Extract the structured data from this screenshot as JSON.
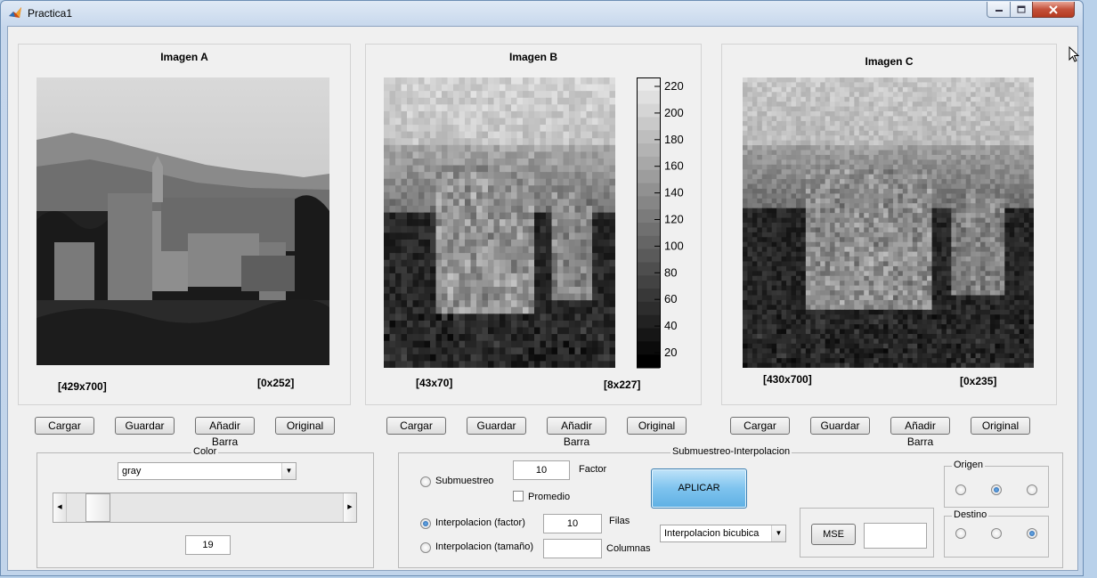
{
  "window": {
    "title": "Practica1"
  },
  "panels": {
    "a": {
      "title": "Imagen A",
      "size_label": "[429x700]",
      "range_label": "[0x252]"
    },
    "b": {
      "title": "Imagen B",
      "size_label": "[43x70]",
      "range_label": "[8x227]"
    },
    "c": {
      "title": "Imagen C",
      "size_label": "[430x700]",
      "range_label": "[0x235]"
    }
  },
  "colorbar": {
    "ticks": [
      "220",
      "200",
      "180",
      "160",
      "140",
      "120",
      "100",
      "80",
      "60",
      "40",
      "20"
    ]
  },
  "buttons": {
    "cargar": "Cargar",
    "guardar": "Guardar",
    "anadir_barra": "Añadir Barra",
    "original": "Original"
  },
  "color_group": {
    "label": "Color",
    "colormap_selected": "gray",
    "slider_value": "19"
  },
  "sub_group": {
    "label": "Submuestreo-Interpolacion",
    "submuestreo_label": "Submuestreo",
    "factor_value": "10",
    "factor_label": "Factor",
    "promedio_label": "Promedio",
    "interp_factor_label": "Interpolacion (factor)",
    "filas_value": "10",
    "filas_label": "Filas",
    "interp_tamano_label": "Interpolacion (tamaño)",
    "columnas_value": "",
    "columnas_label": "Columnas",
    "aplicar_label": "APLICAR",
    "method_selected": "Interpolacion bicubica",
    "mse_label": "MSE",
    "mse_value": "",
    "origen_label": "Origen",
    "destino_label": "Destino"
  }
}
